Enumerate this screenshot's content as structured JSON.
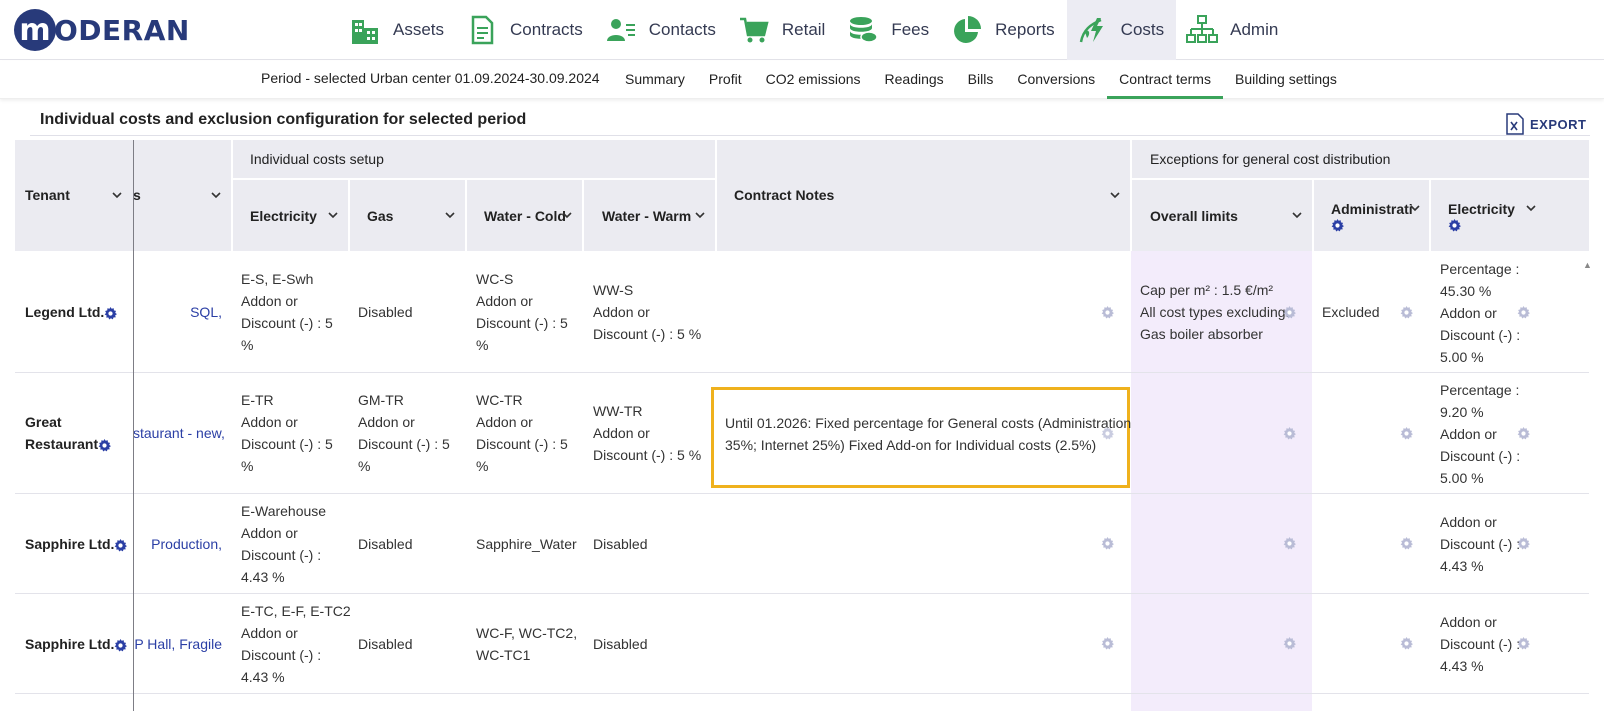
{
  "brand": {
    "logo_letter": "m",
    "logo_text": "ODERAN"
  },
  "nav": {
    "items": [
      {
        "label": "Assets",
        "icon": "building-icon"
      },
      {
        "label": "Contracts",
        "icon": "document-icon"
      },
      {
        "label": "Contacts",
        "icon": "contacts-icon"
      },
      {
        "label": "Retail",
        "icon": "cart-icon"
      },
      {
        "label": "Fees",
        "icon": "coins-icon"
      },
      {
        "label": "Reports",
        "icon": "pie-chart-icon"
      },
      {
        "label": "Costs",
        "icon": "costs-icon",
        "active": true
      },
      {
        "label": "Admin",
        "icon": "org-chart-icon"
      }
    ],
    "icon_color": "#3aa35a"
  },
  "subnav": {
    "period": "Period - selected Urban center 01.09.2024-30.09.2024",
    "tabs": [
      {
        "label": "Summary"
      },
      {
        "label": "Profit"
      },
      {
        "label": "CO2 emissions"
      },
      {
        "label": "Readings"
      },
      {
        "label": "Bills"
      },
      {
        "label": "Conversions"
      },
      {
        "label": "Contract terms",
        "active": true
      },
      {
        "label": "Building settings"
      }
    ]
  },
  "page": {
    "title": "Individual costs and exclusion configuration for selected period",
    "export_label": "EXPORT"
  },
  "table": {
    "headers": {
      "tenant": "Tenant",
      "col2": "s",
      "group_individual": "Individual costs setup",
      "electricity": "Electricity",
      "gas": "Gas",
      "water_cold": "Water - Cold",
      "water_warm": "Water - Warm",
      "contract_notes": "Contract Notes",
      "group_exceptions": "Exceptions for general cost distribution",
      "overall_limits": "Overall limits",
      "administration": "Administratio",
      "electricity2": "Electricity"
    },
    "rows": [
      {
        "tenant": [
          "Legend Ltd."
        ],
        "premises": "SQL,",
        "electricity": [
          "E-S, E-Swh",
          "Addon or",
          "Discount (-) : 5",
          "%"
        ],
        "gas": [
          "Disabled"
        ],
        "water_cold": [
          "WC-S",
          "Addon or",
          "Discount (-) : 5",
          "%"
        ],
        "water_warm": [
          "WW-S",
          "Addon or",
          "Discount (-) : 5 %"
        ],
        "notes": [],
        "limits": [
          "Cap per m² : 1.5 €/m²",
          "All cost types excluding:",
          "Gas boiler absorber"
        ],
        "administration": [
          "Excluded"
        ],
        "electricity2": [
          "Percentage :",
          "45.30 %",
          "Addon or",
          "Discount (-) :",
          "5.00 %"
        ]
      },
      {
        "tenant": [
          "Great",
          "Restaurant"
        ],
        "premises": "staurant - new,",
        "electricity": [
          "E-TR",
          "Addon or",
          "Discount (-) : 5",
          "%"
        ],
        "gas": [
          "GM-TR",
          "Addon or",
          "Discount (-) : 5",
          "%"
        ],
        "water_cold": [
          "WC-TR",
          "Addon or",
          "Discount (-) : 5",
          "%"
        ],
        "water_warm": [
          "WW-TR",
          "Addon or",
          "Discount (-) : 5 %"
        ],
        "notes": [
          "Until 01.2026: Fixed percentage for General costs (Administration",
          "35%; Internet 25%) Fixed Add-on for Individual costs (2.5%)"
        ],
        "limits": [],
        "administration": [],
        "electricity2": [
          "Percentage :",
          "9.20 %",
          "Addon or",
          "Discount (-) :",
          "5.00 %"
        ]
      },
      {
        "tenant": [
          "Sapphire Ltd."
        ],
        "premises": "Production,",
        "electricity": [
          "E-Warehouse",
          "Addon or",
          "Discount (-) :",
          "4.43 %"
        ],
        "gas": [
          "Disabled"
        ],
        "water_cold": [
          "Sapphire_Water"
        ],
        "water_warm": [
          "Disabled"
        ],
        "notes": [],
        "limits": [],
        "administration": [],
        "electricity2": [
          "Addon or",
          "Discount (-) :",
          "4.43 %"
        ]
      },
      {
        "tenant": [
          "Sapphire Ltd."
        ],
        "premises": "OP Hall, Fragile,",
        "electricity": [
          "E-TC, E-F, E-TC2",
          "Addon or",
          "Discount (-) :",
          "4.43 %"
        ],
        "gas": [
          "Disabled"
        ],
        "water_cold": [
          "WC-F, WC-TC2,",
          "WC-TC1"
        ],
        "water_warm": [
          "Disabled"
        ],
        "notes": [],
        "limits": [],
        "administration": [],
        "electricity2": [
          "Addon or",
          "Discount (-) :",
          "4.43 %"
        ]
      }
    ]
  },
  "colors": {
    "brand": "#283a7a",
    "accent_green": "#3aa35a",
    "header_bg": "#ebebf1",
    "highlight_border": "#efb11d",
    "highlight_column": "#f3ecfb",
    "link": "#2b3fa5"
  }
}
